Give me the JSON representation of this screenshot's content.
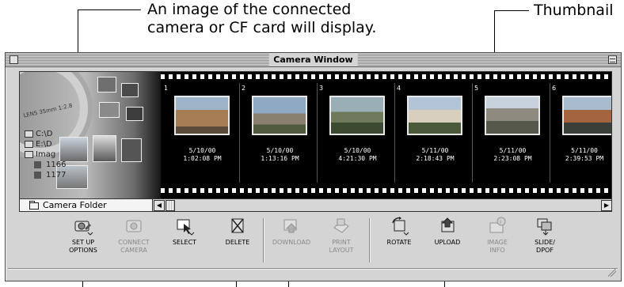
{
  "callouts": {
    "camera_line1": "An image of the connected",
    "camera_line2": "camera or CF card will display.",
    "thumbnail": "Thumbnail"
  },
  "window": {
    "title": "Camera Window",
    "folder_label": "Camera Folder"
  },
  "camera_panel": {
    "lens_text": "LENS 35mm 1:2.8",
    "tree_items": [
      "C:\\D",
      "E:\\D",
      "Imag",
      "1166",
      "1177"
    ]
  },
  "thumbnails": [
    {
      "number": "1",
      "date": "5/10/00",
      "time": "1:02:08 PM"
    },
    {
      "number": "2",
      "date": "5/10/00",
      "time": "1:13:16 PM"
    },
    {
      "number": "3",
      "date": "5/10/00",
      "time": "4:21:30 PM"
    },
    {
      "number": "4",
      "date": "5/11/00",
      "time": "2:18:43 PM"
    },
    {
      "number": "5",
      "date": "5/11/00",
      "time": "2:23:08 PM"
    },
    {
      "number": "6",
      "date": "5/11/00",
      "time": "2:39:53 PM"
    }
  ],
  "toolbar": {
    "setup": "SET UP\nOPTIONS",
    "connect": "CONNECT\nCAMERA",
    "select": "SELECT",
    "delete": "DELETE",
    "download": "DOWNLOAD",
    "print": "PRINT\nLAYOUT",
    "rotate": "ROTATE",
    "upload": "UPLOAD",
    "image_info": "IMAGE\nINFO",
    "slide": "SLIDE/\nDPOF"
  },
  "icons": {
    "close": "close-box-icon",
    "zoom": "zoom-box-icon",
    "folder": "folder-icon",
    "scroll_left": "◀",
    "scroll_right": "▶"
  },
  "colors": {
    "window_bg": "#d4d4d4",
    "film_strip": "#000000",
    "disabled_text": "#8a8a8a"
  }
}
